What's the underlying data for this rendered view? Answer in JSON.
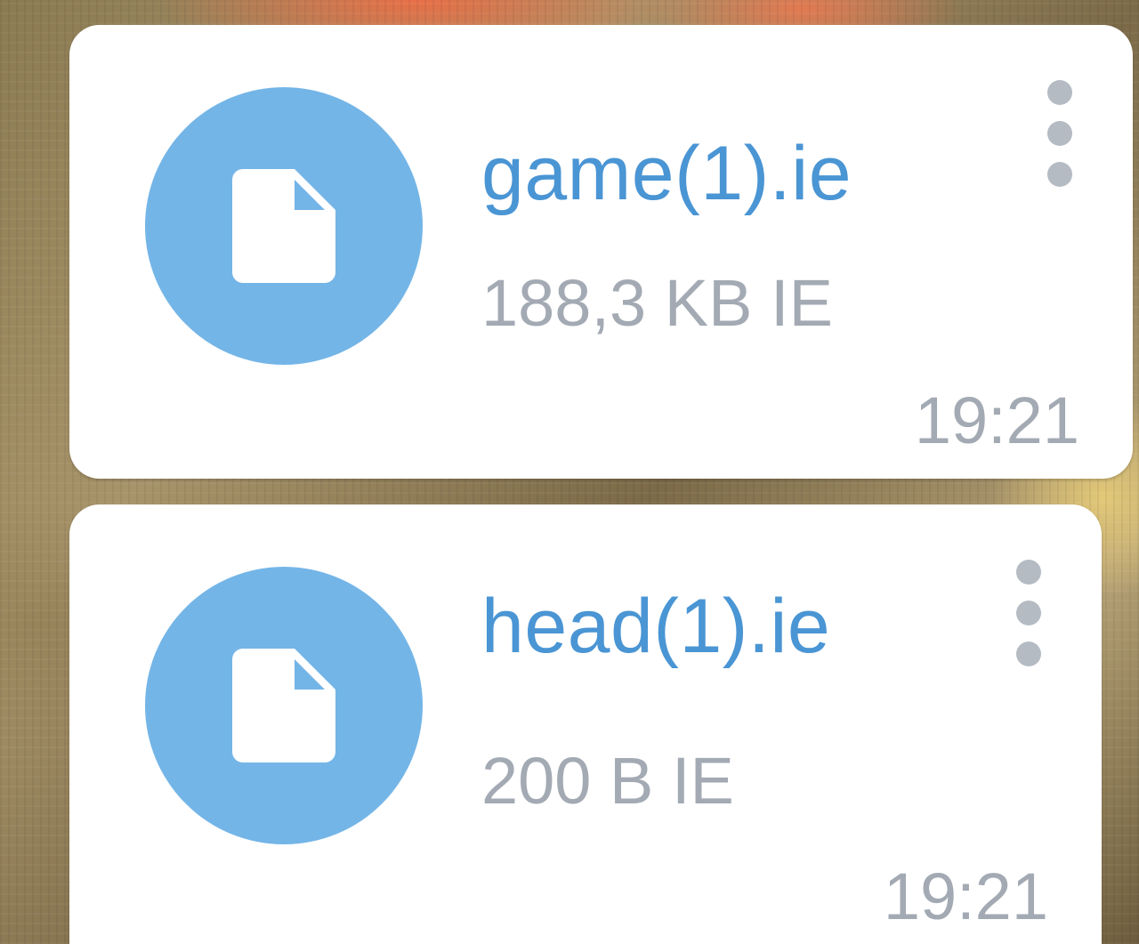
{
  "messages": [
    {
      "file_name": "game(1).ie",
      "file_meta": "188,3 KB IE",
      "time": "19:21",
      "icon": "file-icon"
    },
    {
      "file_name": "head(1).ie",
      "file_meta": "200 B IE",
      "time": "19:21",
      "icon": "file-icon"
    }
  ],
  "colors": {
    "accent": "#4a95d4",
    "icon_circle": "#74b5e7",
    "secondary_text": "#a3aab3",
    "bubble": "#ffffff"
  }
}
